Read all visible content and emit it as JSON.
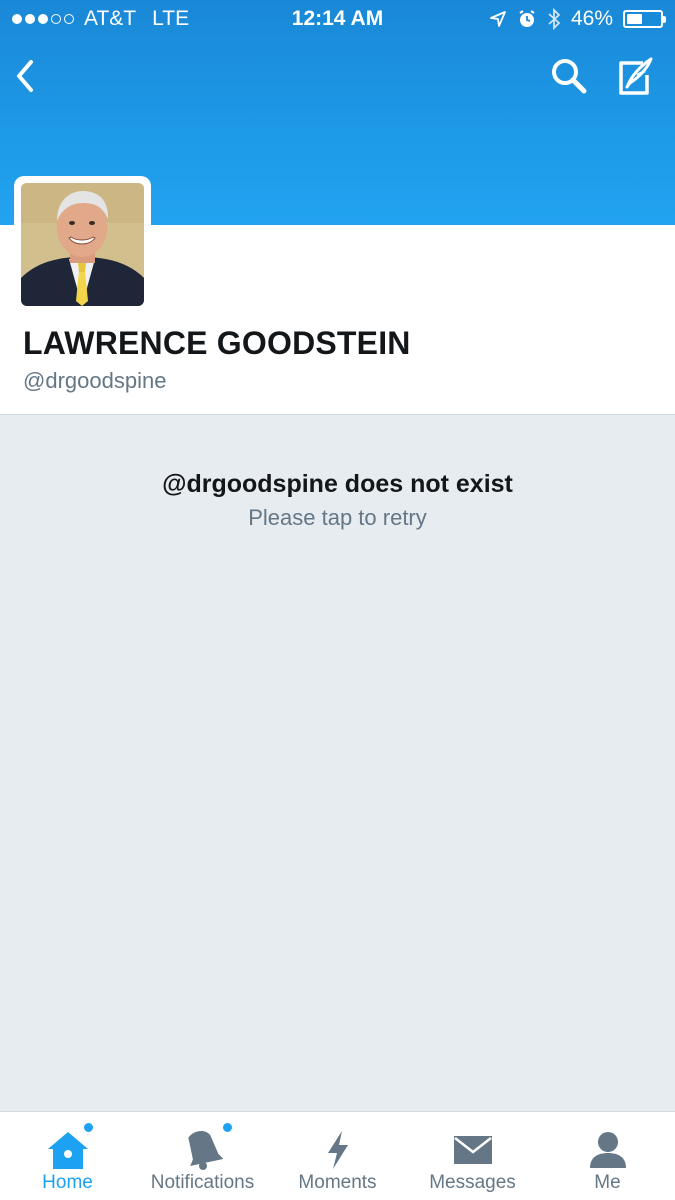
{
  "status_bar": {
    "carrier": "AT&T",
    "network": "LTE",
    "time": "12:14 AM",
    "battery": "46%",
    "battery_level": 0.46,
    "signal_full": 3,
    "signal_total": 5
  },
  "nav": {
    "back_icon": "chevron-left-icon",
    "search_icon": "search-icon",
    "compose_icon": "compose-icon"
  },
  "profile": {
    "name": "LAWRENCE GOODSTEIN",
    "handle": "@drgoodspine"
  },
  "error": {
    "title": "@drgoodspine does not exist",
    "retry": "Please tap to retry"
  },
  "tabs": [
    {
      "label": "Home",
      "icon": "home-icon",
      "active": true,
      "badge": true
    },
    {
      "label": "Notifications",
      "icon": "bell-icon",
      "active": false,
      "badge": true
    },
    {
      "label": "Moments",
      "icon": "lightning-icon",
      "active": false,
      "badge": false
    },
    {
      "label": "Messages",
      "icon": "envelope-icon",
      "active": false,
      "badge": false
    },
    {
      "label": "Me",
      "icon": "person-icon",
      "active": false,
      "badge": false
    }
  ],
  "colors": {
    "brand_blue": "#1da1f2",
    "banner_top": "#1a88d6",
    "background": "#e6ecf0",
    "text_primary": "#14171a",
    "text_secondary": "#657786"
  }
}
